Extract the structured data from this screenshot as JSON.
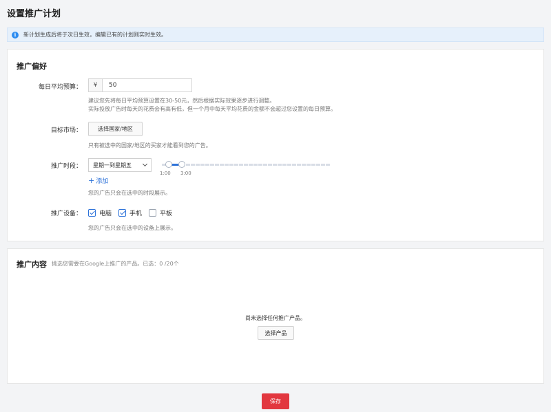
{
  "page": {
    "title": "设置推广计划"
  },
  "notice": {
    "icon": "info-icon",
    "text": "新计划生成后将于次日生效，编辑已有的计划则实时生效。"
  },
  "preferences": {
    "title": "推广偏好",
    "budget": {
      "label": "每日平均预算：",
      "currency": "¥",
      "value": "50",
      "hint_line1": "建议您先将每日平均预算设置在30-50元，然后根据实际效果逐步进行调整。",
      "hint_line2": "实际投放广告时每天的花费会有高有低，但一个月中每天平均花费的金额不会超过您设置的每日预算。"
    },
    "market": {
      "label": "目标市场：",
      "button": "选择国家/地区",
      "hint": "只有被选中的国家/地区的买家才能看到您的广告。"
    },
    "schedule": {
      "label": "推广时段：",
      "selected": "星期一到星期五",
      "tick_start": "1:00",
      "tick_end": "3:00",
      "add_label": "添加",
      "hint": "您的广告只会在选中的时段展示。"
    },
    "devices": {
      "label": "推广设备：",
      "options": [
        {
          "label": "电脑",
          "checked": true
        },
        {
          "label": "手机",
          "checked": true
        },
        {
          "label": "平板",
          "checked": false
        }
      ],
      "hint": "您的广告只会在选中的设备上展示。"
    }
  },
  "content": {
    "title": "推广内容",
    "subtitle": "挑选您需要在Google上推广的产品。已选：0 /20个",
    "empty_text": "尚未选择任何推广产品。",
    "select_button": "选择产品"
  },
  "footer": {
    "save_label": "保存"
  },
  "colors": {
    "accent": "#2d72d9",
    "danger": "#e2373f",
    "info": "#2d8cf0"
  }
}
